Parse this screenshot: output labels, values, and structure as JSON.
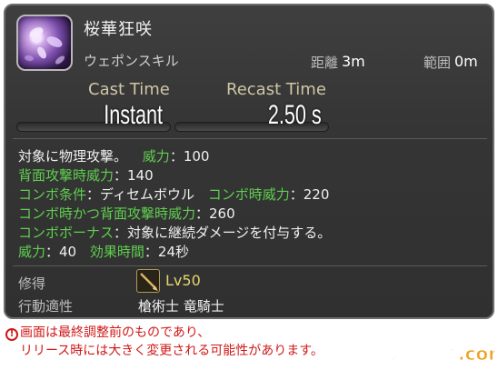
{
  "skill": {
    "name": "桜華狂咲",
    "type": "ウェポンスキル",
    "range_label": "距離",
    "range_value": "3m",
    "radius_label": "範囲",
    "radius_value": "0m",
    "cast_label": "Cast Time",
    "cast_value": "Instant",
    "recast_label": "Recast Time",
    "recast_value": "2.50 s"
  },
  "description": {
    "line1_text": "対象に物理攻撃。",
    "line1_key": "威力",
    "line1_val": "：100",
    "line2_key": "背面攻撃時威力",
    "line2_val": "：140",
    "line3_key1": "コンボ条件",
    "line3_val1": "：ディセムボウル",
    "line3_key2": "コンボ時威力",
    "line3_val2": "：220",
    "line4_key": "コンボ時かつ背面攻撃時威力",
    "line4_val": "：260",
    "line5_key": "コンボボーナス",
    "line5_val": "：対象に継続ダメージを付与する。",
    "line6_key1": "威力",
    "line6_val1": "：40",
    "line6_key2": "効果時間",
    "line6_val2": "：24秒"
  },
  "acquire": {
    "label": "修得",
    "level": "Lv50",
    "job_label": "行動適性",
    "jobs": "槍術士 竜騎士"
  },
  "note": {
    "icon": "!",
    "line1": "画面は最終調整前のものであり、",
    "line2": "リリース時には大きく変更される可能性があります。"
  },
  "watermark": {
    "text": "ファミ通.com"
  },
  "colors": {
    "accent_green": "#5fcf4f",
    "level_yellow": "#e4d76a",
    "note_red": "#d01818",
    "logo_orange": "#f0a020"
  }
}
